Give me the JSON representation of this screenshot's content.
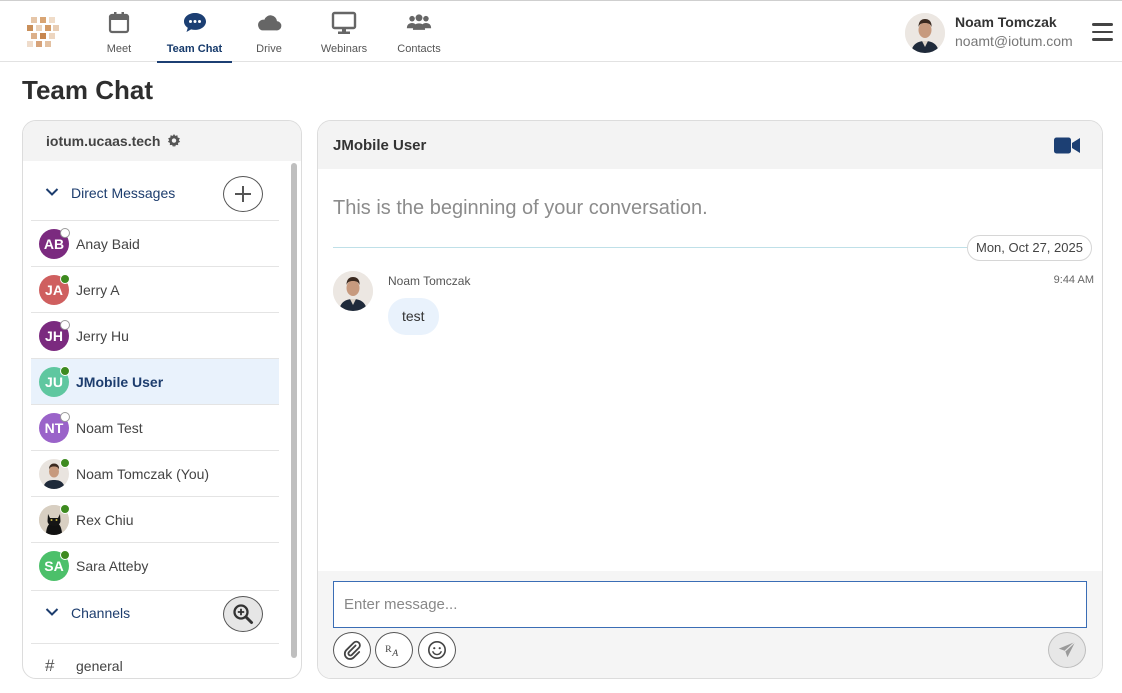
{
  "nav": {
    "tabs": [
      {
        "label": "Meet",
        "icon": "calendar-icon"
      },
      {
        "label": "Team Chat",
        "icon": "chat-bubble-icon",
        "active": true
      },
      {
        "label": "Drive",
        "icon": "cloud-icon"
      },
      {
        "label": "Webinars",
        "icon": "monitor-icon"
      },
      {
        "label": "Contacts",
        "icon": "people-icon"
      }
    ],
    "user": {
      "name": "Noam Tomczak",
      "email": "noamt@iotum.com"
    },
    "menu_icon": "hamburger-menu-icon"
  },
  "page": {
    "title": "Team Chat"
  },
  "sidebar": {
    "workspace": "iotum.ucaas.tech",
    "direct_messages": {
      "title": "Direct Messages",
      "items": [
        {
          "initials": "AB",
          "name": "Anay Baid",
          "color": "#7b2a7f",
          "status": "offline"
        },
        {
          "initials": "JA",
          "name": "Jerry A",
          "color": "#cf5f5f",
          "status": "online"
        },
        {
          "initials": "JH",
          "name": "Jerry Hu",
          "color": "#7b2a7f",
          "status": "offline"
        },
        {
          "initials": "JU",
          "name": "JMobile User",
          "color": "#5fc7a0",
          "status": "online",
          "selected": true
        },
        {
          "initials": "NT",
          "name": "Noam Test",
          "color": "#9a63c9",
          "status": "offline"
        },
        {
          "initials": "",
          "name": "Noam Tomczak (You)",
          "color": "#e9e4df",
          "status": "online",
          "photo": "person"
        },
        {
          "initials": "",
          "name": "Rex Chiu",
          "color": "#d8cfc2",
          "status": "online",
          "photo": "cat"
        },
        {
          "initials": "SA",
          "name": "Sara Atteby",
          "color": "#4cc06a",
          "status": "online"
        }
      ]
    },
    "channels": {
      "title": "Channels",
      "items": [
        {
          "name": "general"
        }
      ]
    }
  },
  "chat": {
    "title": "JMobile User",
    "start_text": "This is the beginning of your conversation.",
    "date": "Mon, Oct 27, 2025",
    "messages": [
      {
        "author": "Noam Tomczak",
        "time": "9:44 AM",
        "text": "test"
      }
    ],
    "input": {
      "placeholder": "Enter message...",
      "value": ""
    }
  },
  "colors": {
    "brand": "#1d3d6e",
    "accent": "#1c3f73",
    "selected_bg": "#e9f2fc",
    "online": "#3d8a1f"
  }
}
